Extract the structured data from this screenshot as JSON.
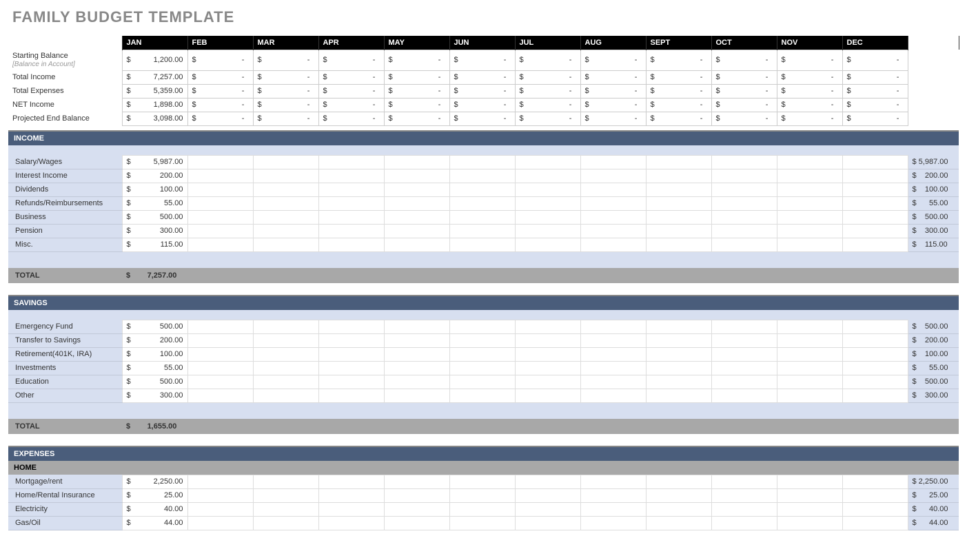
{
  "title": "FAMILY BUDGET TEMPLATE",
  "months": [
    "JAN",
    "FEB",
    "MAR",
    "APR",
    "MAY",
    "JUN",
    "JUL",
    "AUG",
    "SEPT",
    "OCT",
    "NOV",
    "DEC"
  ],
  "summary": {
    "rows": [
      {
        "label": "Starting Balance",
        "sublabel": "[Balance in Account]",
        "jan": "1,200.00"
      },
      {
        "label": "Total Income",
        "jan": "7,257.00"
      },
      {
        "label": "Total Expenses",
        "jan": "5,359.00"
      },
      {
        "label": "NET Income",
        "jan": "1,898.00"
      },
      {
        "label": "Projected End Balance",
        "jan": "3,098.00"
      }
    ]
  },
  "income": {
    "header": "INCOME",
    "rows": [
      {
        "label": "Salary/Wages",
        "jan": "5,987.00",
        "total": "$ 5,987.00"
      },
      {
        "label": "Interest Income",
        "jan": "200.00",
        "total": "$    200.00"
      },
      {
        "label": "Dividends",
        "jan": "100.00",
        "total": "$    100.00"
      },
      {
        "label": "Refunds/Reimbursements",
        "jan": "55.00",
        "total": "$      55.00"
      },
      {
        "label": "Business",
        "jan": "500.00",
        "total": "$    500.00"
      },
      {
        "label": "Pension",
        "jan": "300.00",
        "total": "$    300.00"
      },
      {
        "label": "Misc.",
        "jan": "115.00",
        "total": "$    115.00"
      }
    ],
    "total_label": "TOTAL",
    "total_value": "$        7,257.00"
  },
  "savings": {
    "header": "SAVINGS",
    "rows": [
      {
        "label": "Emergency Fund",
        "jan": "500.00",
        "total": "$    500.00"
      },
      {
        "label": "Transfer to Savings",
        "jan": "200.00",
        "total": "$    200.00"
      },
      {
        "label": "Retirement(401K, IRA)",
        "jan": "100.00",
        "total": "$    100.00"
      },
      {
        "label": "Investments",
        "jan": "55.00",
        "total": "$      55.00"
      },
      {
        "label": "Education",
        "jan": "500.00",
        "total": "$    500.00"
      },
      {
        "label": "Other",
        "jan": "300.00",
        "total": "$    300.00"
      }
    ],
    "total_label": "TOTAL",
    "total_value": "$        1,655.00"
  },
  "expenses": {
    "header": "EXPENSES",
    "subheader": "HOME",
    "rows": [
      {
        "label": "Mortgage/rent",
        "jan": "2,250.00",
        "total": "$ 2,250.00"
      },
      {
        "label": "Home/Rental Insurance",
        "jan": "25.00",
        "total": "$      25.00"
      },
      {
        "label": "Electricity",
        "jan": "40.00",
        "total": "$      40.00"
      },
      {
        "label": "Gas/Oil",
        "jan": "44.00",
        "total": "$      44.00"
      }
    ]
  }
}
